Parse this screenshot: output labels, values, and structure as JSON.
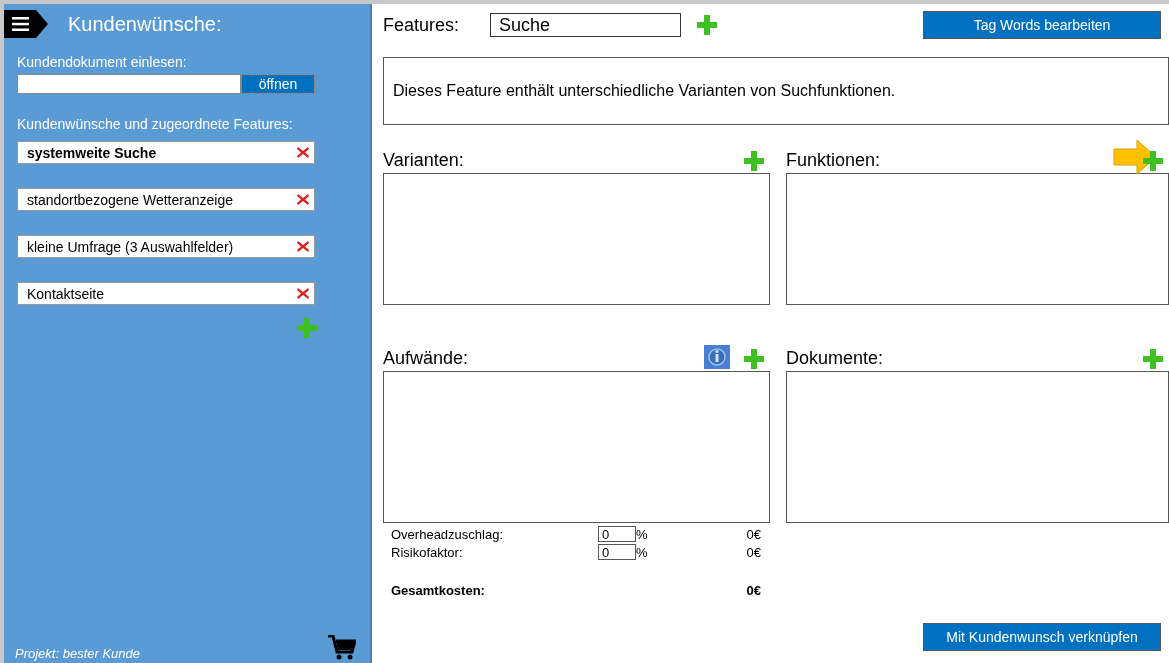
{
  "sidebar": {
    "title": "Kundenwünsche:",
    "import_label": "Kundendokument einlesen:",
    "open_button": "öffnen",
    "wishes_label": "Kundenwünsche und zugeordnete Features:",
    "wishes": [
      {
        "label": "systemweite Suche",
        "selected": true
      },
      {
        "label": "standortbezogene Wetteranzeige",
        "selected": false
      },
      {
        "label": "kleine Umfrage (3 Auswahlfelder)",
        "selected": false
      },
      {
        "label": "Kontaktseite",
        "selected": false
      }
    ],
    "project": "Projekt: bester Kunde"
  },
  "main": {
    "features_label": "Features:",
    "feature_field": {
      "value": "Suche"
    },
    "tag_button": "Tag Words bearbeiten",
    "description": "Dieses Feature enthält unterschiedliche Varianten von Suchfunktionen.",
    "panels": [
      {
        "title": "Varianten:"
      },
      {
        "title": "Funktionen:"
      },
      {
        "title": "Aufwände:"
      },
      {
        "title": "Dokumente:"
      }
    ],
    "costs": [
      {
        "label": "Overheadzuschlag:",
        "value": "0",
        "unit": "%",
        "amount": "0€"
      },
      {
        "label": "Risikofaktor:",
        "value": "0",
        "unit": "%",
        "amount": "0€"
      }
    ],
    "total": {
      "label": "Gesamtkosten:",
      "amount": "0€"
    },
    "link_button": "Mit Kundenwunsch verknüpfen"
  }
}
